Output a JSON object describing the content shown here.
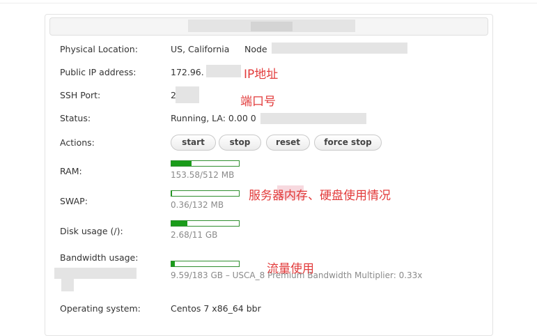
{
  "rows": {
    "location": {
      "label": "Physical Location:",
      "value": "US, California",
      "node_label": "Node"
    },
    "ip": {
      "label": "Public IP address:",
      "value": "172.96."
    },
    "ssh": {
      "label": "SSH Port:",
      "value": "2"
    },
    "status": {
      "label": "Status:",
      "value": "Running, LA: 0.00 0"
    },
    "actions": {
      "label": "Actions:",
      "buttons": [
        "start",
        "stop",
        "reset",
        "force stop"
      ]
    },
    "ram": {
      "label": "RAM:",
      "text": "153.58/512 MB",
      "fraction": 0.3
    },
    "swap": {
      "label": "SWAP:",
      "text": "0.36/132 MB",
      "fraction": 0.003
    },
    "disk": {
      "label": "Disk usage (/):",
      "text": "2.68/11 GB",
      "fraction": 0.24
    },
    "bandwidth": {
      "label": "Bandwidth usage:",
      "text": "9.59/183 GB – USCA_8 Premium Bandwidth Multiplier: 0.33x",
      "fraction": 0.052
    },
    "os": {
      "label": "Operating system:",
      "value": "Centos 7 x86_64 bbr"
    }
  },
  "annotations": {
    "ip": "IP地址",
    "port": "端口号",
    "memory_disk": "服务器内存、硬盘使用情况",
    "traffic": "流量使用"
  },
  "colors": {
    "bar_fill": "#1a9c1a",
    "bar_border": "#2f8f2f",
    "annotation": "#e23b3b"
  }
}
